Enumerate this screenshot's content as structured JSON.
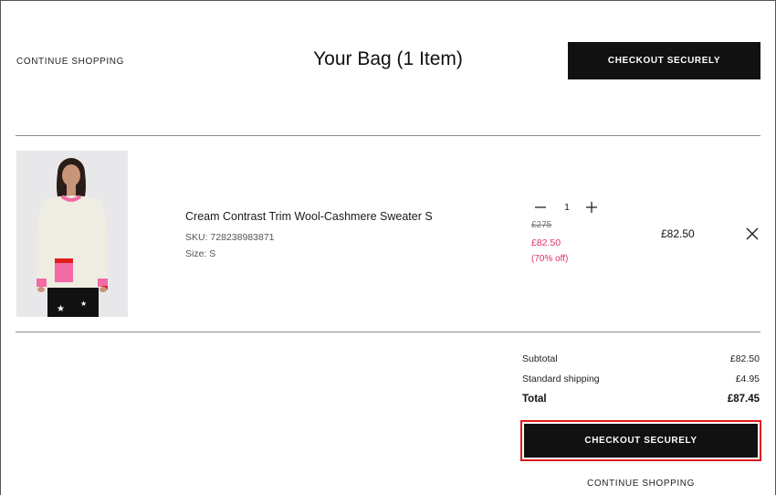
{
  "header": {
    "continue_shopping": "CONTINUE SHOPPING",
    "title": "Your Bag (1 Item)",
    "checkout_label": "CHECKOUT SECURELY"
  },
  "item": {
    "name": "Cream Contrast Trim Wool-Cashmere Sweater S",
    "sku": "SKU: 728238983871",
    "size": "Size: S",
    "quantity": "1",
    "price_original": "£275",
    "price_sale": "£82.50",
    "discount": "(70% off)",
    "line_total": "£82.50",
    "image_icon": "product-photo"
  },
  "summary": {
    "subtotal_label": "Subtotal",
    "subtotal_value": "£82.50",
    "shipping_label": "Standard shipping",
    "shipping_value": "£4.95",
    "total_label": "Total",
    "total_value": "£87.45"
  },
  "footer": {
    "checkout_label": "CHECKOUT SECURELY",
    "continue_shopping": "CONTINUE SHOPPING"
  },
  "colors": {
    "button_bg": "#111111",
    "sale_color": "#e0306e",
    "highlight_outline": "#e01a1a"
  }
}
